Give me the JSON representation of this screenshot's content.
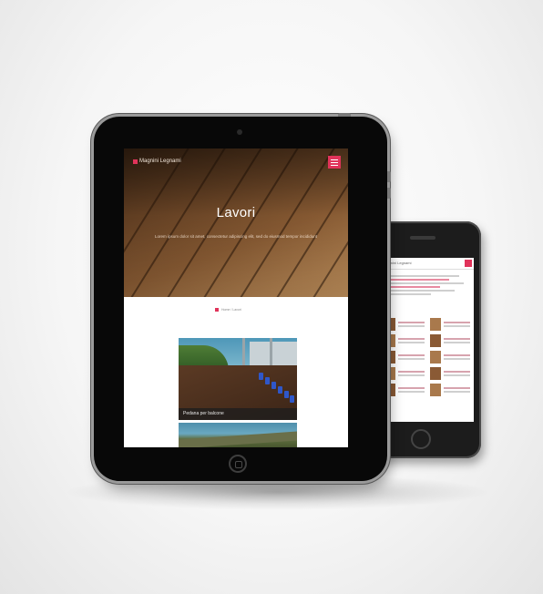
{
  "tablet": {
    "site_logo": "Magnini Legnami",
    "menu_icon": "hamburger-menu-icon",
    "hero_title": "Lavori",
    "hero_subtitle": "Lorem ipsum dolor sit amet, consectetur adipiscing elit, sed do eiusmod tempor incididunt",
    "breadcrumb": "Home / Lavori",
    "project_card_label": "Pedana per balcone"
  },
  "phone": {
    "site_logo": "Magnini Legnami"
  },
  "colors": {
    "accent": "#e0335a",
    "wood_dark": "#3a2413",
    "wood_light": "#c79660",
    "device_body": "#080808"
  }
}
